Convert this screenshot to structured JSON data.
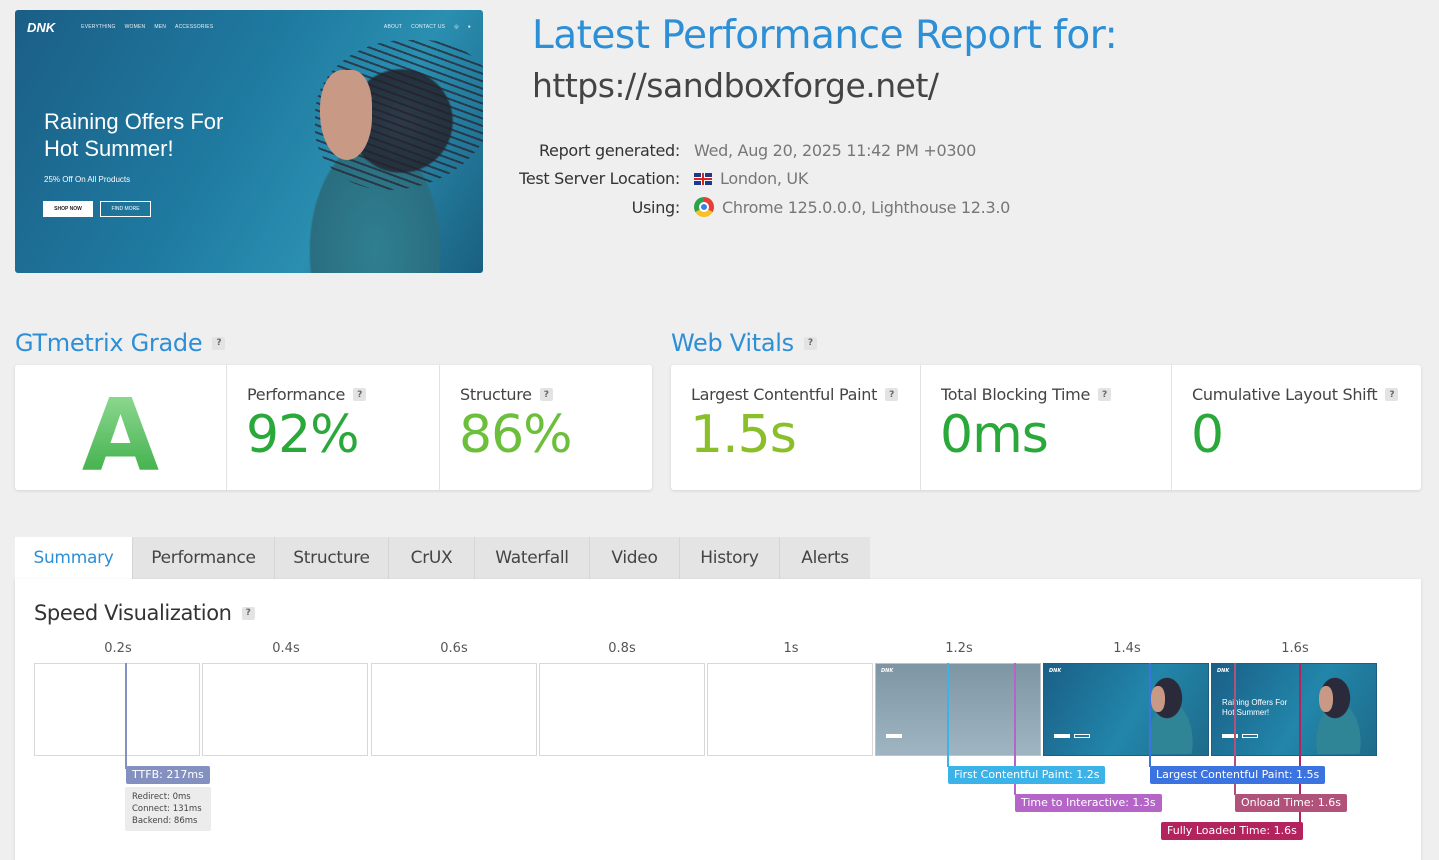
{
  "site_preview": {
    "logo": "DNK",
    "nav_left": [
      "EVERYTHING",
      "WOMEN",
      "MEN",
      "ACCESSORIES"
    ],
    "nav_right": [
      "ABOUT",
      "CONTACT US"
    ],
    "headline_line1": "Raining Offers For",
    "headline_line2": "Hot Summer!",
    "subtext": "25% Off On All Products",
    "shop_button": "SHOP NOW",
    "more_button": "FIND MORE"
  },
  "report": {
    "title": "Latest Performance Report for:",
    "url": "https://sandboxforge.net/",
    "generated_label": "Report generated:",
    "generated_value": "Wed, Aug 20, 2025 11:42 PM +0300",
    "location_label": "Test Server Location:",
    "location_value": "London, UK",
    "using_label": "Using:",
    "using_value": "Chrome 125.0.0.0, Lighthouse 12.3.0"
  },
  "grade": {
    "heading": "GTmetrix Grade",
    "letter": "A",
    "performance_label": "Performance",
    "performance_value": "92%",
    "structure_label": "Structure",
    "structure_value": "86%"
  },
  "vitals": {
    "heading": "Web Vitals",
    "lcp_label": "Largest Contentful Paint",
    "lcp_value": "1.5s",
    "tbt_label": "Total Blocking Time",
    "tbt_value": "0ms",
    "cls_label": "Cumulative Layout Shift",
    "cls_value": "0"
  },
  "tabs": [
    "Summary",
    "Performance",
    "Structure",
    "CrUX",
    "Waterfall",
    "Video",
    "History",
    "Alerts"
  ],
  "speed": {
    "title": "Speed Visualization",
    "ticks": [
      "0.2s",
      "0.4s",
      "0.6s",
      "0.8s",
      "1s",
      "1.2s",
      "1.4s",
      "1.6s"
    ],
    "ttfb": "TTFB: 217ms",
    "ttfb_redirect": "Redirect: 0ms",
    "ttfb_connect": "Connect: 131ms",
    "ttfb_backend": "Backend: 86ms",
    "fcp": "First Contentful Paint: 1.2s",
    "tti": "Time to Interactive: 1.3s",
    "lcp": "Largest Contentful Paint: 1.5s",
    "onload": "Onload Time: 1.6s",
    "fully_loaded": "Fully Loaded Time: 1.6s",
    "frame_title_line1": "Raining Offers For",
    "frame_title_line2": "Hot Summer!"
  },
  "colors": {
    "accent": "#2d8fd6",
    "grade_green": "#3db046",
    "perf_green": "#2aa83a",
    "struct_green": "#6cbf3a",
    "lcp_green": "#8bbf2a",
    "tbt_green": "#2aa83a",
    "cls_green": "#2aa83a",
    "ttfb": "#8390c0",
    "fcp": "#3bb3e8",
    "tti": "#b565c8",
    "lcp_marker": "#3b73e0",
    "onload": "#b0527a",
    "fully_loaded": "#b3245e"
  }
}
